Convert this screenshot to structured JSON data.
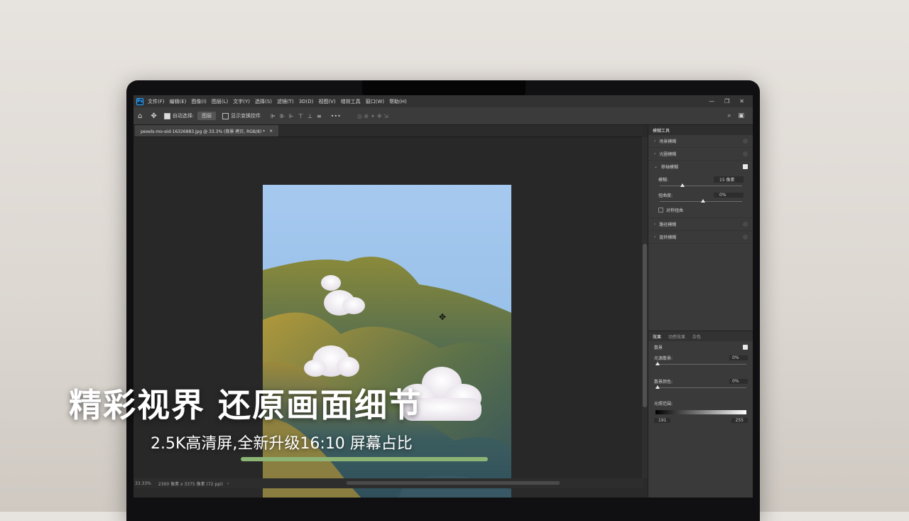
{
  "app": {
    "menu": [
      "文件(F)",
      "编辑(E)",
      "图像(I)",
      "图层(L)",
      "文字(Y)",
      "选择(S)",
      "滤镜(T)",
      "3D(D)",
      "视图(V)",
      "增效工具",
      "窗口(W)",
      "帮助(H)"
    ],
    "window_controls": [
      "—",
      "❐",
      "✕"
    ]
  },
  "options_bar": {
    "auto_select_label": "自动选择:",
    "auto_select_value": "图层",
    "show_transform_label": "显示变换控件"
  },
  "document": {
    "tab_title": "pexels-mo-eid-16326883.jpg @ 33.3% (背景 拷贝, RGB/8) *",
    "tab_close": "×"
  },
  "status_bar": {
    "zoom": "33.33%",
    "info": "2300 像素 x 3375 像素 (72 ppi)",
    "arrow": "›"
  },
  "panel": {
    "title": "模糊工具",
    "blurs": [
      {
        "label": "场景模糊",
        "checked": false
      },
      {
        "label": "光圈模糊",
        "checked": false
      },
      {
        "label": "移轴模糊",
        "checked": true
      },
      {
        "label": "路径模糊",
        "checked": false
      },
      {
        "label": "旋转模糊",
        "checked": false
      }
    ],
    "tilt": {
      "blur_label": "模糊:",
      "blur_value": "15 像素",
      "blur_level": 0.25,
      "distortion_label": "扭曲度:",
      "distortion_value": "0%",
      "distortion_level": 0.5,
      "symmetric_label": "对称扭曲"
    },
    "tabs": [
      "效果",
      "动感效果",
      "杂色"
    ],
    "effects": {
      "bokeh_label": "散景",
      "light_bokeh_label": "光源散景:",
      "light_bokeh_value": "0%",
      "bokeh_color_label": "散景颜色:",
      "bokeh_color_value": "0%",
      "light_range_label": "光照范围:",
      "range_low": "191",
      "range_high": "255"
    }
  },
  "overlay": {
    "headline": "精彩视界 还原画面细节",
    "subline": "2.5K高清屏,全新升级16:10 屏幕占比"
  },
  "colors": {
    "accent_bar": "#8cb474",
    "ps_blue": "#31a8ff"
  }
}
